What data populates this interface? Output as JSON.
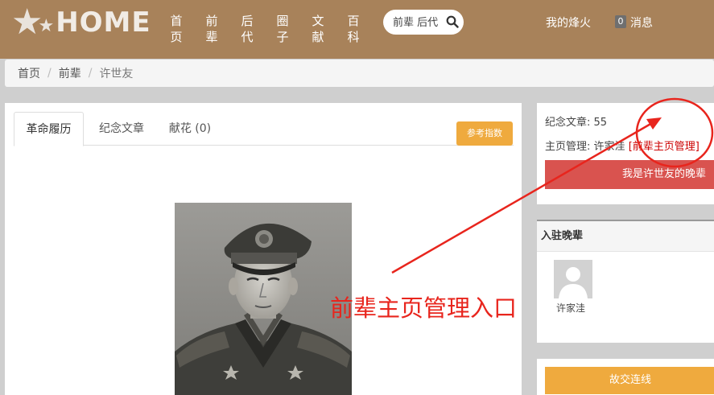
{
  "header": {
    "logo_text": "HOME",
    "nav": [
      {
        "label_top": "首",
        "label_bottom": "页"
      },
      {
        "label_top": "前",
        "label_bottom": "辈"
      },
      {
        "label_top": "后",
        "label_bottom": "代"
      },
      {
        "label_top": "圈",
        "label_bottom": "子"
      },
      {
        "label_top": "文",
        "label_bottom": "献"
      },
      {
        "label_top": "百",
        "label_bottom": "科"
      }
    ],
    "search": {
      "value": "前辈 后代",
      "icon": "search-icon"
    },
    "my_fire": "我的烽火",
    "message_count": "0",
    "message_label": "消息"
  },
  "breadcrumb": [
    "首页",
    "前辈",
    "许世友"
  ],
  "tabs": [
    {
      "label": "革命履历",
      "active": true
    },
    {
      "label": "纪念文章",
      "active": false
    },
    {
      "label": "献花 (0)",
      "active": false
    }
  ],
  "reference_button": "参考指数",
  "sidebar": {
    "article_label": "纪念文章:",
    "article_count": "55",
    "manager_label": "主页管理:",
    "manager_name": "许家洼",
    "manager_link": "[前辈主页管理]",
    "descendant_button": "我是许世友的晚辈",
    "members_heading": "入驻晚辈",
    "member_name": "许家洼",
    "friend_button": "故交连线"
  },
  "annotation": {
    "text": "前辈主页管理入口",
    "color": "#e8251d"
  },
  "colors": {
    "header_bg": "#a8825a",
    "accent_orange": "#efaa3e",
    "accent_red": "#d9534f",
    "link_red": "#cc0000"
  }
}
